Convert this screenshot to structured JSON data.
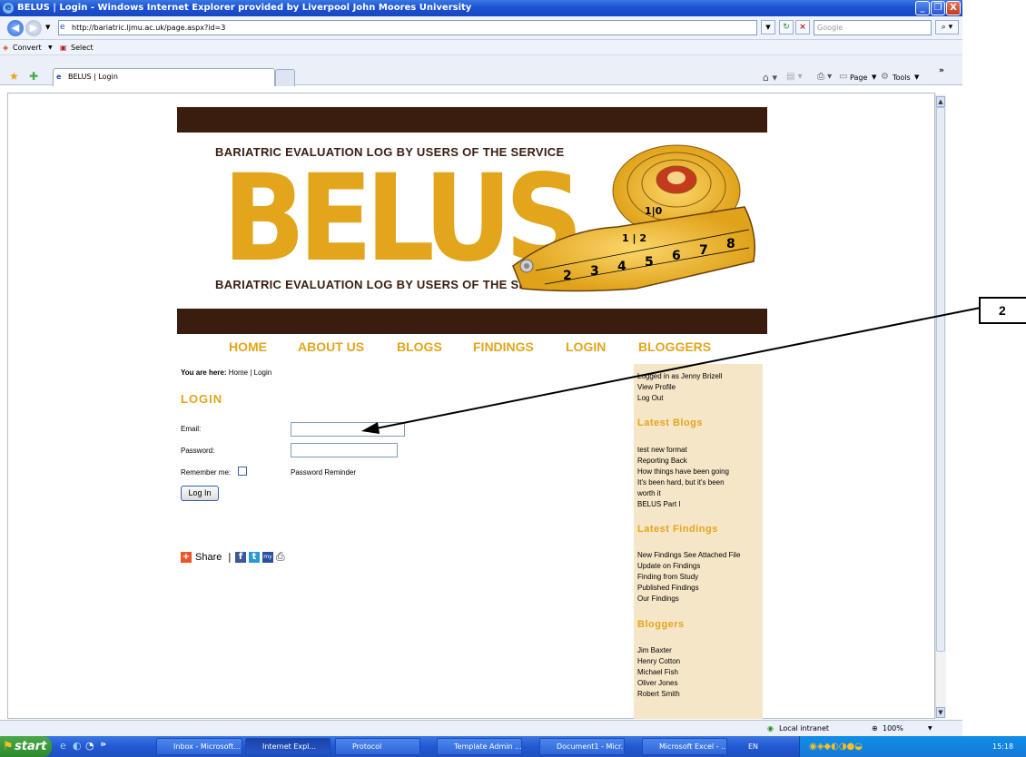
{
  "window": {
    "title": "BELUS | Login - Windows Internet Explorer provided by Liverpool John Moores University",
    "minimize": "_",
    "maximize": "❐",
    "close": "X"
  },
  "browser": {
    "url": "http://bariatric.ljmu.ac.uk/page.aspx?id=3",
    "search_placeholder": "Google",
    "convert_label": "Convert",
    "select_label": "Select",
    "tab_label": "BELUS | Login",
    "page_menu": "Page",
    "tools_menu": "Tools"
  },
  "site": {
    "tagline": "BARIATRIC EVALUATION LOG BY USERS OF THE SERVICE",
    "logo": "BELUS",
    "nav": [
      "HOME",
      "ABOUT US",
      "BLOGS",
      "FINDINGS",
      "LOGIN",
      "BLOGGERS"
    ]
  },
  "breadcrumb": {
    "prefix": "You are here:",
    "path": "Home | Login"
  },
  "login": {
    "heading": "LOGIN",
    "email_label": "Email:",
    "email_value": "",
    "password_label": "Password:",
    "password_value": "",
    "remember_label": "Remember me:",
    "remember_checked": false,
    "reminder_link": "Password Reminder",
    "submit_label": "Log In"
  },
  "share": {
    "label": "Share",
    "separator": "|"
  },
  "sidebar": {
    "logged_in": "Logged in as Jenny Brizell",
    "view_profile": "View Profile",
    "log_out": "Log Out",
    "blogs_heading": "Latest Blogs",
    "blogs": [
      "test new format",
      "Reporting Back",
      "How things have been going",
      "It's been hard, but it's been worth it",
      "BELUS Part I"
    ],
    "findings_heading": "Latest Findings",
    "findings": [
      "New Findings See Attached File",
      "Update on Findings",
      "Finding from Study",
      "Published Findings",
      "Our Findings"
    ],
    "bloggers_heading": "Bloggers",
    "bloggers": [
      "Jim Baxter",
      "Henry Cotton",
      "Michael Fish",
      "Oliver Jones",
      "Robert Smith"
    ]
  },
  "status": {
    "zone": "Local intranet",
    "zoom": "100%"
  },
  "taskbar": {
    "start": "start",
    "buttons": [
      "Inbox - Microsoft...",
      "Internet Expl...",
      "Protocol",
      "Template Admin ...",
      "Document1 - Micr...",
      "Microsoft Excel - ..."
    ],
    "lang": "EN",
    "clock": "15:18"
  },
  "callout": {
    "number": "2"
  }
}
